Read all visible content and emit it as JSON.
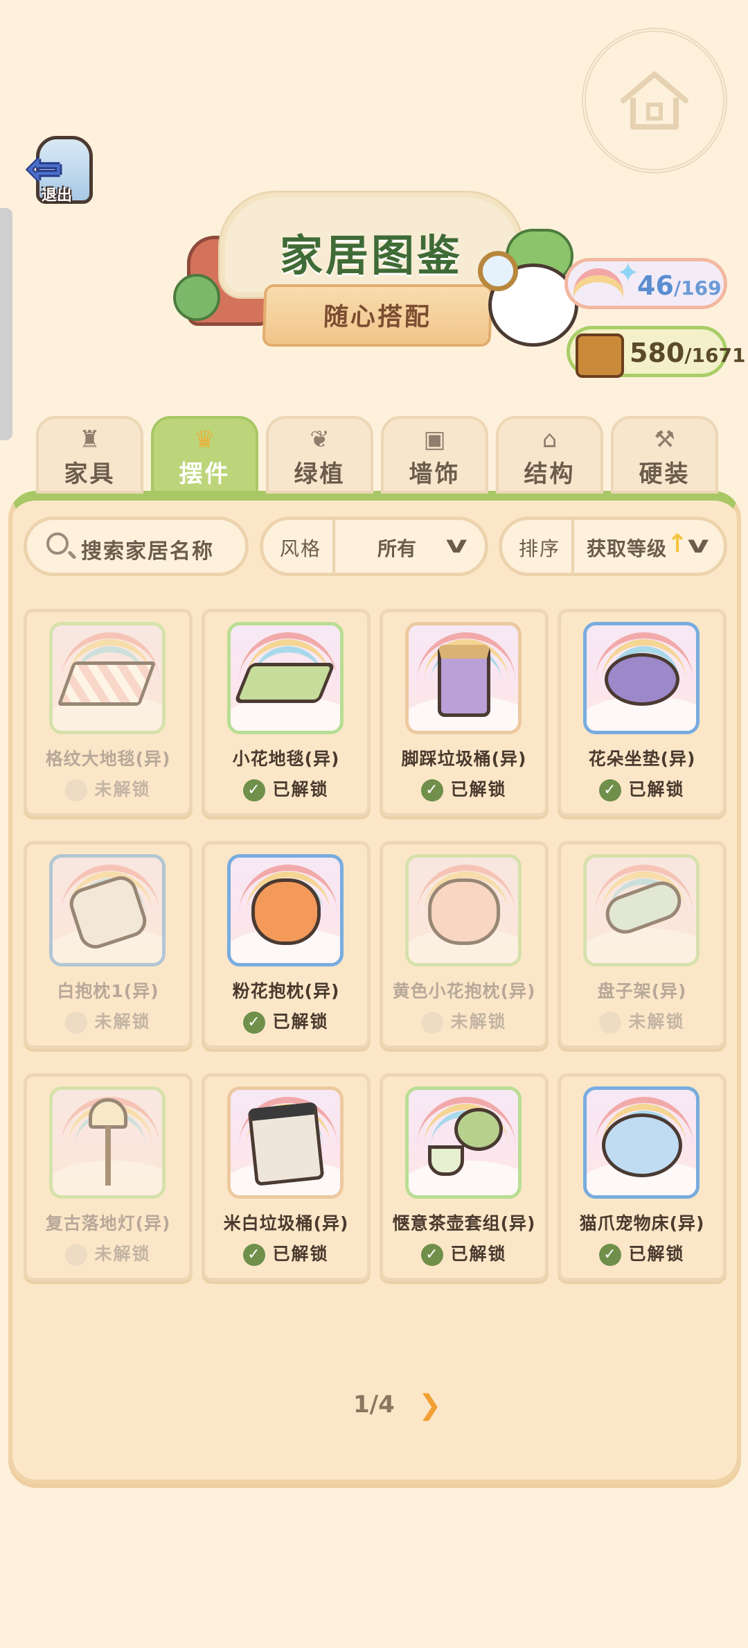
{
  "header": {
    "exit_label": "退出",
    "title": "家居图鉴",
    "subtitle": "随心搭配"
  },
  "counters": {
    "collection": {
      "current": "46",
      "total": "/169",
      "icon": "rainbow-star-icon"
    },
    "score": {
      "current": "580",
      "total": "/1671",
      "icon": "book-icon"
    }
  },
  "tabs": [
    {
      "label": "家具",
      "icon": "chair-icon",
      "active": false
    },
    {
      "label": "摆件",
      "icon": "lamp-icon",
      "active": true
    },
    {
      "label": "绿植",
      "icon": "leaf-icon",
      "active": false
    },
    {
      "label": "墙饰",
      "icon": "picture-icon",
      "active": false
    },
    {
      "label": "结构",
      "icon": "house-icon",
      "active": false
    },
    {
      "label": "硬装",
      "icon": "hammer-icon",
      "active": false
    }
  ],
  "search": {
    "placeholder": "搜索家居名称"
  },
  "filter": {
    "label": "风格",
    "value": "所有"
  },
  "sort": {
    "label": "排序",
    "value": "获取等级"
  },
  "items": [
    {
      "name": "格纹大地毯(异)",
      "status": "未解锁",
      "unlocked": false
    },
    {
      "name": "小花地毯(异)",
      "status": "已解锁",
      "unlocked": true
    },
    {
      "name": "脚踩垃圾桶(异)",
      "status": "已解锁",
      "unlocked": true
    },
    {
      "name": "花朵坐垫(异)",
      "status": "已解锁",
      "unlocked": true
    },
    {
      "name": "白抱枕1(异)",
      "status": "未解锁",
      "unlocked": false
    },
    {
      "name": "粉花抱枕(异)",
      "status": "已解锁",
      "unlocked": true
    },
    {
      "name": "黄色小花抱枕(异)",
      "status": "未解锁",
      "unlocked": false
    },
    {
      "name": "盘子架(异)",
      "status": "未解锁",
      "unlocked": false
    },
    {
      "name": "复古落地灯(异)",
      "status": "未解锁",
      "unlocked": false
    },
    {
      "name": "米白垃圾桶(异)",
      "status": "已解锁",
      "unlocked": true
    },
    {
      "name": "惬意茶壶套组(异)",
      "status": "已解锁",
      "unlocked": true
    },
    {
      "name": "猫爪宠物床(异)",
      "status": "已解锁",
      "unlocked": true
    }
  ],
  "pagination": {
    "text": "1/4"
  },
  "colors": {
    "accent_green": "#a8c765",
    "title_green": "#3f6b36",
    "counter_blue": "#5b8ed1"
  }
}
